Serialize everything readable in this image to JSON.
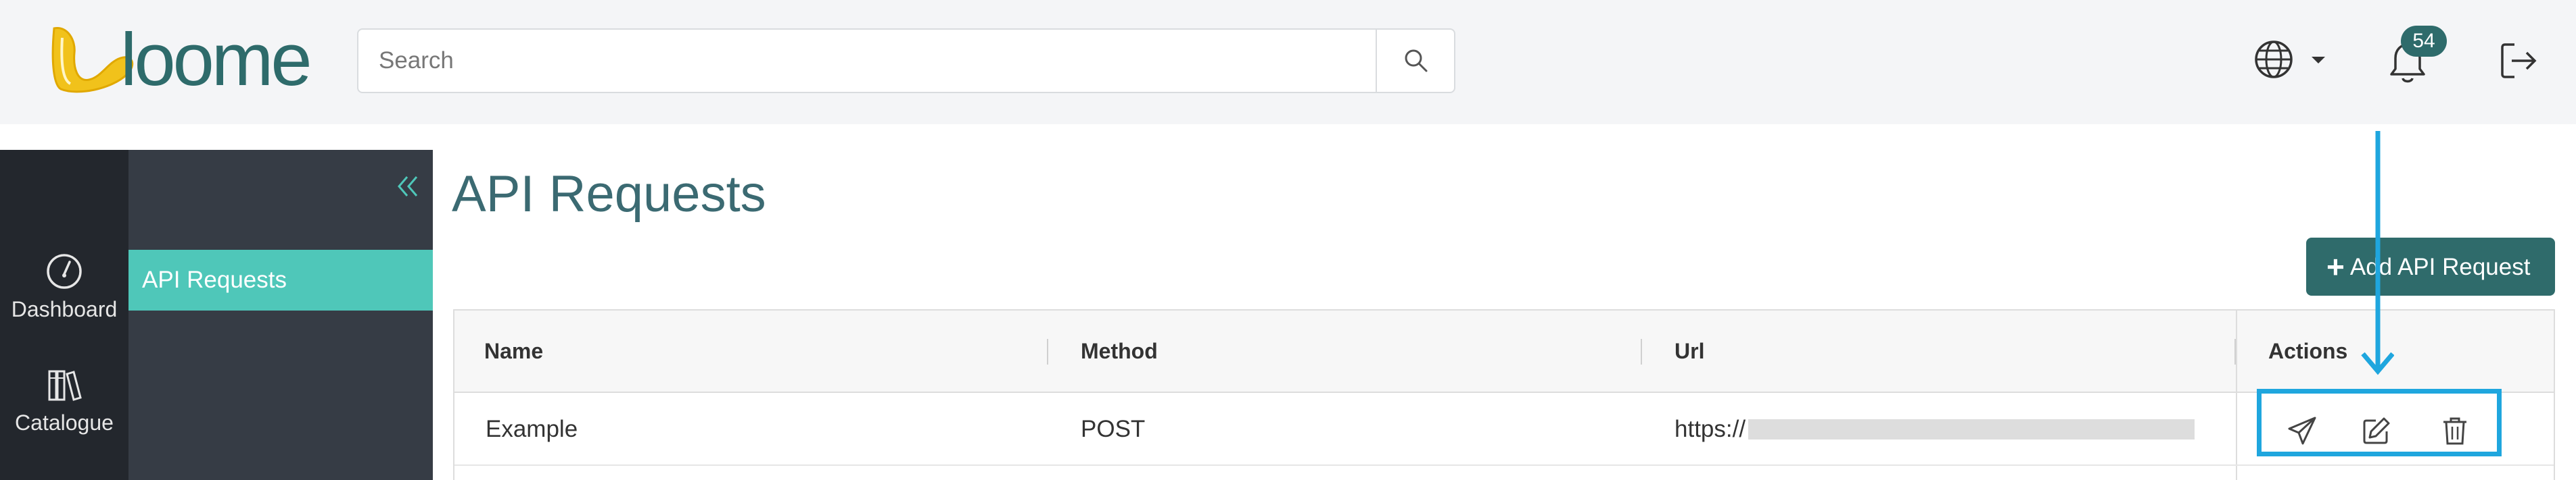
{
  "brand": {
    "name": "loome",
    "accent": "#2e6b6b",
    "highlight": "#4fc7b9",
    "annotation_color": "#1fa6de"
  },
  "header": {
    "search": {
      "placeholder": "Search",
      "value": ""
    },
    "notifications": {
      "count": "54"
    },
    "icons": [
      "search-icon",
      "globe-icon",
      "chevron-down-icon",
      "bell-icon",
      "logout-icon"
    ]
  },
  "rail": {
    "items": [
      {
        "label": "Dashboard",
        "icon": "gauge-icon"
      },
      {
        "label": "Catalogue",
        "icon": "books-icon"
      }
    ]
  },
  "subnav": {
    "collapse_icon": "double-chevron-left-icon",
    "items": [
      {
        "label": "API Requests",
        "active": true
      }
    ]
  },
  "main": {
    "title": "API Requests",
    "add_button": {
      "plus": "+",
      "label": "Add API Request"
    },
    "table": {
      "columns": [
        "Name",
        "Method",
        "Url",
        "Actions"
      ],
      "rows": [
        {
          "name": "Example",
          "method": "POST",
          "url": "https://",
          "url_redacted": true
        }
      ],
      "row_actions": [
        "send-icon",
        "edit-icon",
        "trash-icon"
      ]
    }
  }
}
